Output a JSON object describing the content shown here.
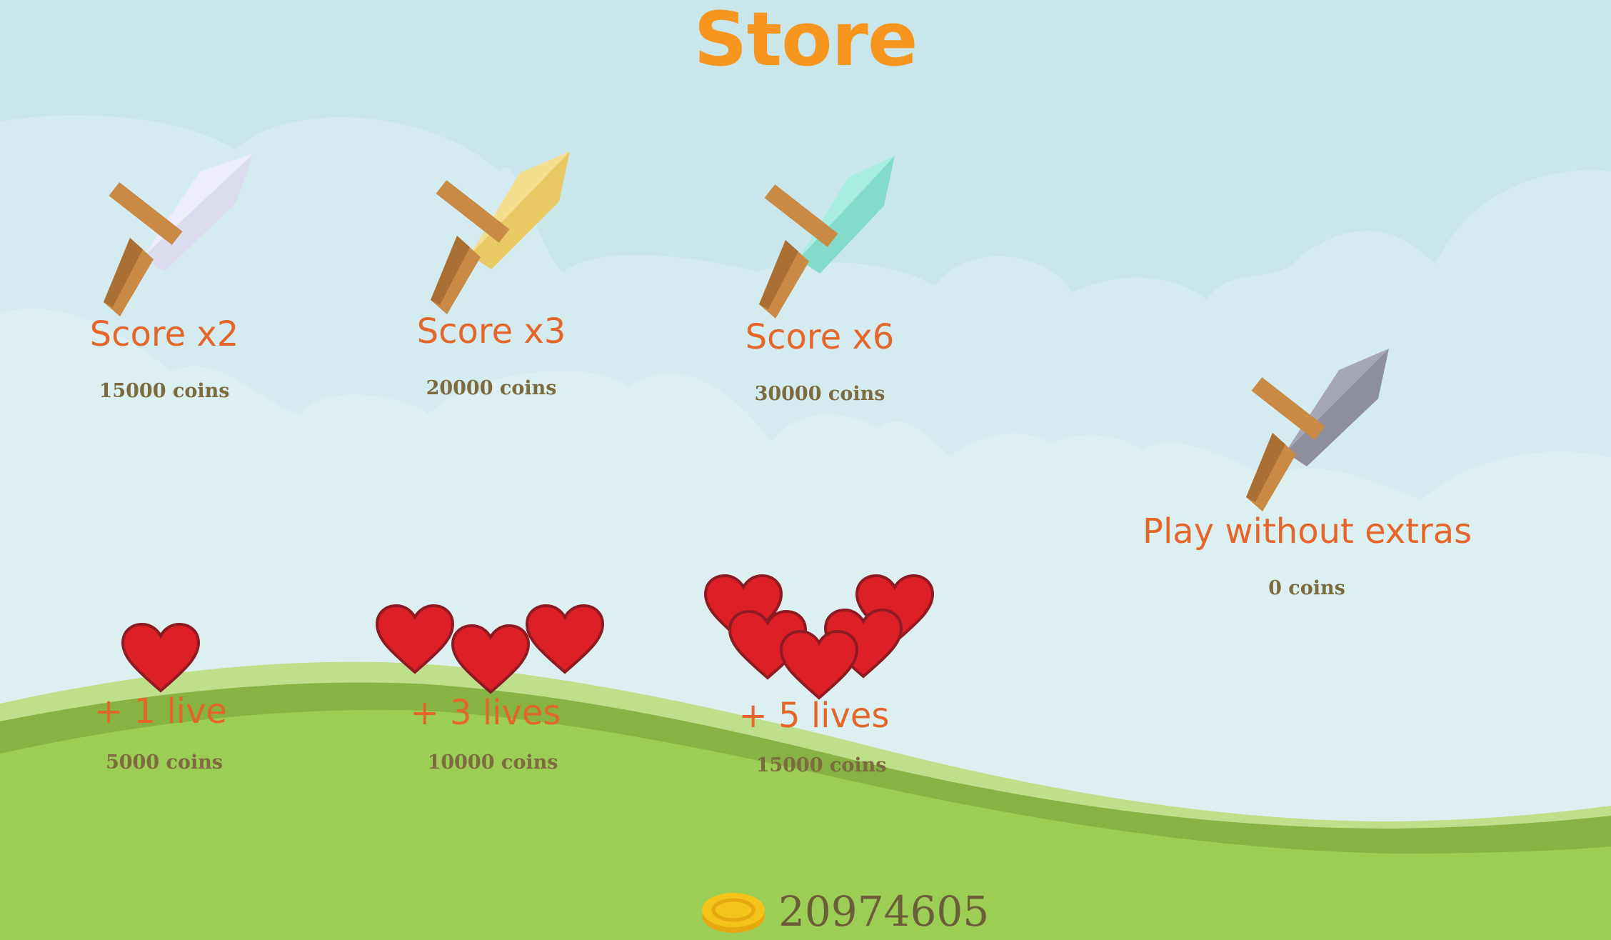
{
  "title": "Store",
  "colors": {
    "title": "#f7961e",
    "label": "#e4662b",
    "price": "#7d6a3e",
    "sky": "#c9e6ea",
    "grass": "#9ccd54",
    "heart": "#dd1f26",
    "coin": "#f4c41a"
  },
  "store_items": [
    {
      "label": "Score x2",
      "price": "15000 coins",
      "icon": "white-sword-icon"
    },
    {
      "label": "Score x3",
      "price": "20000 coins",
      "icon": "gold-sword-icon"
    },
    {
      "label": "Score x6",
      "price": "30000 coins",
      "icon": "diamond-sword-icon"
    },
    {
      "label": "Play without extras",
      "price": "0 coins",
      "icon": "iron-sword-icon"
    },
    {
      "label": "+ 1 live",
      "price": "5000 coins",
      "icon": "heart-icon"
    },
    {
      "label": "+ 3 lives",
      "price": "10000 coins",
      "icon": "hearts-3-icon"
    },
    {
      "label": "+ 5 lives",
      "price": "15000 coins",
      "icon": "hearts-5-icon"
    }
  ],
  "coin_balance": "20974605"
}
